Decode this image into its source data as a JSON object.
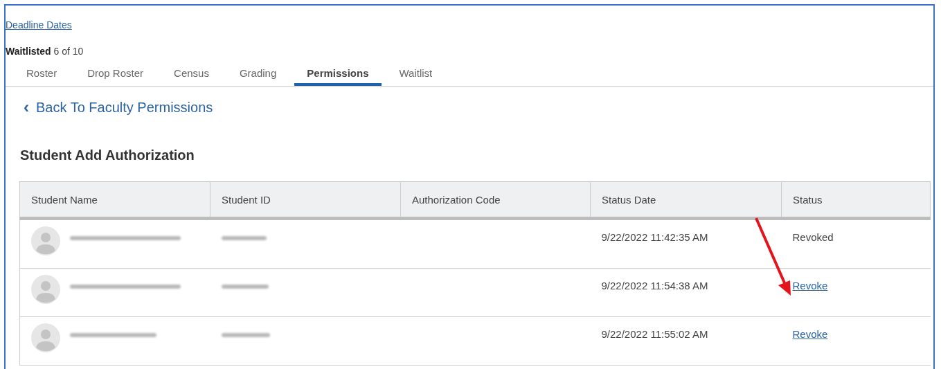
{
  "deadline_link": "Deadline Dates",
  "waitlist": {
    "label": "Waitlisted",
    "count": "6 of 10"
  },
  "tabs": [
    {
      "label": "Roster",
      "selected": false
    },
    {
      "label": "Drop Roster",
      "selected": false
    },
    {
      "label": "Census",
      "selected": false
    },
    {
      "label": "Grading",
      "selected": false
    },
    {
      "label": "Permissions",
      "selected": true
    },
    {
      "label": "Waitlist",
      "selected": false
    }
  ],
  "back_link": {
    "icon": "‹",
    "label": "Back To Faculty Permissions"
  },
  "heading": "Student Add Authorization",
  "table": {
    "columns": [
      "Student Name",
      "Student ID",
      "Authorization Code",
      "Status Date",
      "Status"
    ],
    "rows": [
      {
        "status_date": "9/22/2022 11:42:35 AM",
        "status": {
          "kind": "text",
          "text": "Revoked"
        }
      },
      {
        "status_date": "9/22/2022 11:54:38 AM",
        "status": {
          "kind": "link",
          "text": "Revoke"
        }
      },
      {
        "status_date": "9/22/2022 11:55:02 AM",
        "status": {
          "kind": "link",
          "text": "Revoke"
        }
      }
    ]
  }
}
